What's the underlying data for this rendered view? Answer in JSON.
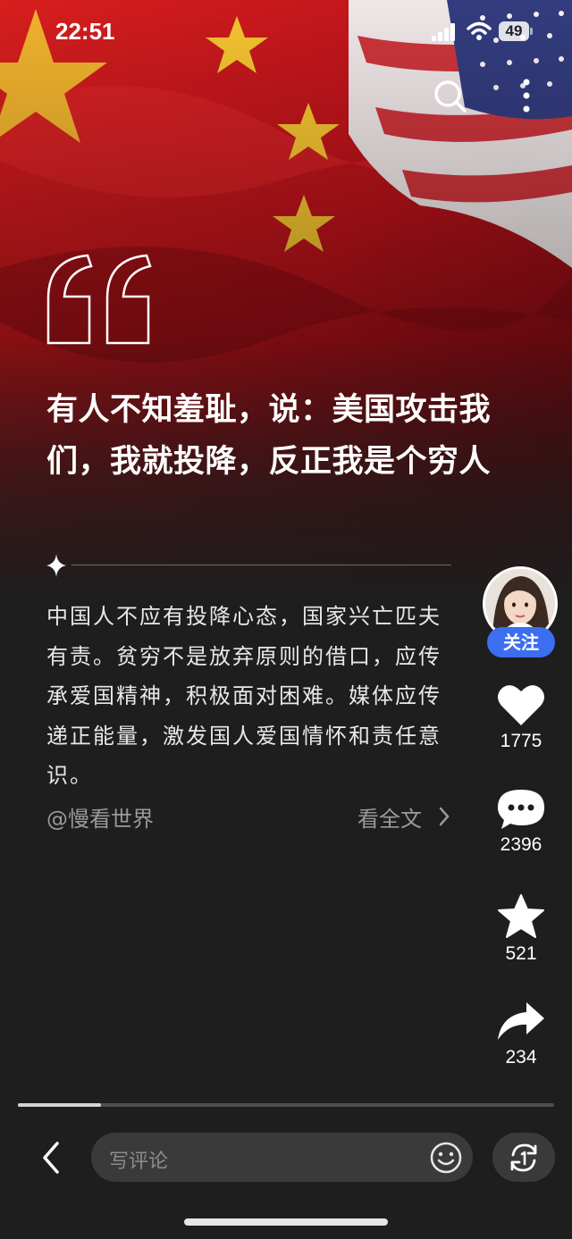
{
  "status_bar": {
    "time": "22:51",
    "battery": "49",
    "icons": [
      "signal-icon",
      "wifi-icon",
      "battery-icon"
    ]
  },
  "top_actions": {
    "icons": [
      "search-icon",
      "more-vertical-icon"
    ]
  },
  "article": {
    "headline": "有人不知羞耻，说：美国攻击我们，我就投降，反正我是个穷人",
    "body": "中国人不应有投降心态，国家兴亡匹夫有责。贫穷不是放弃原则的借口，应传承爱国精神，积极面对困难。媒体应传递正能量，激发国人爱国情怀和责任意识。",
    "author": "@慢看世界",
    "read_more": "看全文"
  },
  "rail": {
    "follow_label": "关注",
    "likes": "1775",
    "comments": "2396",
    "favorites": "521",
    "shares": "234"
  },
  "progress": {
    "fraction": 0.155
  },
  "bottom_bar": {
    "comment_placeholder": "写评论"
  },
  "colors": {
    "background": "#1e1e1e",
    "follow_button": "#3c6ef0",
    "flag_red": "#c8161d",
    "flag_star": "#f4c430"
  }
}
